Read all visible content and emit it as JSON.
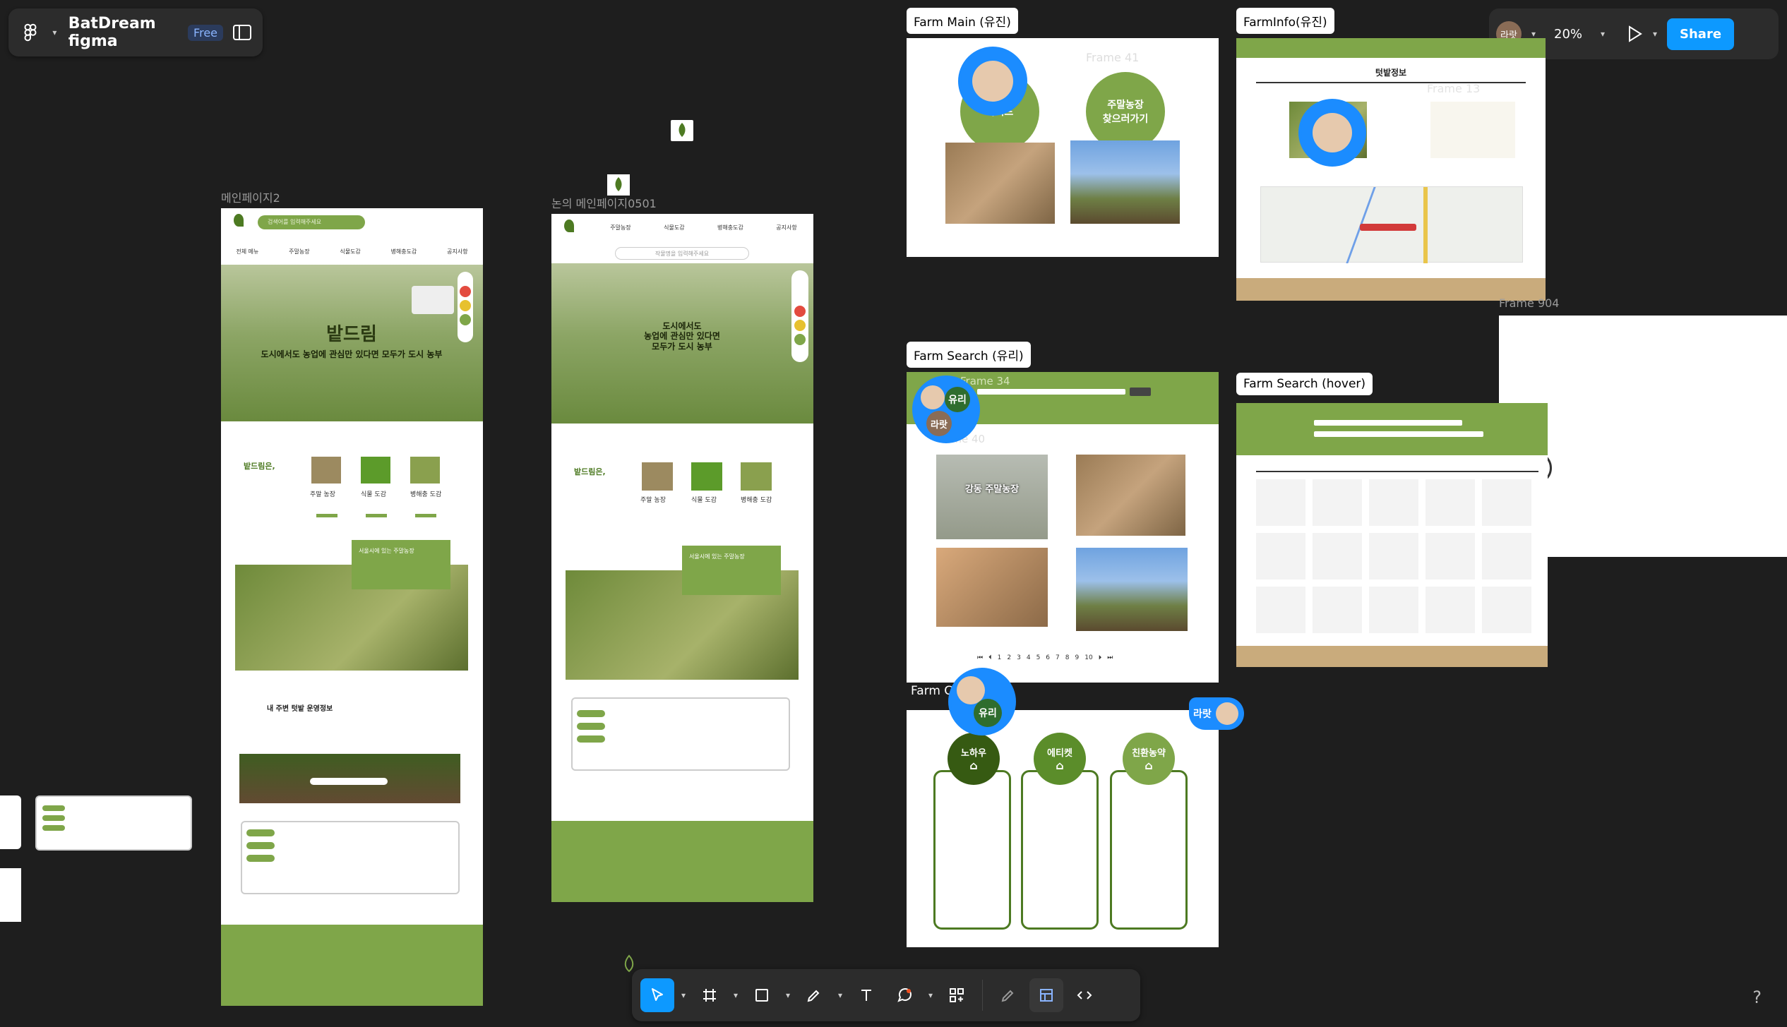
{
  "app": {
    "file_title": "BatDream figma",
    "plan_badge": "Free",
    "zoom": "20%",
    "share_label": "Share",
    "user_avatar": "라랏"
  },
  "frames": {
    "main2": "메인페이지2",
    "main_discussion": "논의 메인페이지0501",
    "farm_main": "Farm Main (유진)",
    "farm_info": "FarmInfo(유진)",
    "farm_search": "Farm Search (유리)",
    "farm_search_hover": "Farm Search (hover)",
    "farm_c": "Farm C",
    "frame_41": "Frame 41",
    "frame_13": "Frame 13",
    "frame_904": "Frame 904",
    "frame_34": "Frame 34",
    "frame_40": "rame 40"
  },
  "main2": {
    "search_placeholder": "검색어를 입력해주세요",
    "nav": [
      "전체 메뉴",
      "주말농장",
      "식물도감",
      "병해충도감",
      "공지사항"
    ],
    "hero_brand": "밭드림",
    "hero_tagline": "도시에서도 농업에 관심만 있다면 모두가 도시 농부",
    "intro_title": "밭드림은,",
    "features": [
      "주말 농장",
      "식물 도감",
      "병해충 도감"
    ],
    "callout": "서울시에 있는 주말농장",
    "weather_title": "내 주변 텃밭 운영정보"
  },
  "main_discussion": {
    "search_placeholder": "작물명을 입력해주세요",
    "nav": [
      "주말농장",
      "식물도감",
      "병해충도감",
      "공지사항"
    ],
    "hero_line1": "도시에서도",
    "hero_line2": "농업에 관심만 있다면",
    "hero_line3": "모두가 도시 농부",
    "intro_title": "밭드림은,",
    "features": [
      "주말 농장",
      "식물 도감",
      "병해충 도감"
    ],
    "callout": "서울시에 있는 주말농장"
  },
  "farm_main": {
    "circle_left": "가이드",
    "circle_right_line1": "주말농장",
    "circle_right_line2": "찾으러가기"
  },
  "farm_info": {
    "header": "텃밭정보"
  },
  "farm_search": {
    "card_title": "강동 주말농장",
    "pagination": [
      "1",
      "2",
      "3",
      "4",
      "5",
      "6",
      "7",
      "8",
      "9",
      "10"
    ]
  },
  "farm_c": {
    "cards": [
      "노하우",
      "에티켓",
      "친환농약"
    ]
  },
  "cursors": {
    "yuri": "유리",
    "larat": "라랏"
  }
}
